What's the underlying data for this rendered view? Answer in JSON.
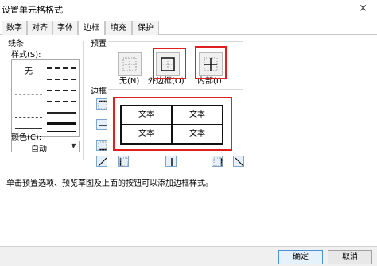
{
  "window": {
    "title": "设置单元格格式",
    "close_glyph": "×"
  },
  "tabs": [
    {
      "label": "数字"
    },
    {
      "label": "对齐"
    },
    {
      "label": "字体"
    },
    {
      "label": "边框"
    },
    {
      "label": "填充"
    },
    {
      "label": "保护"
    }
  ],
  "active_tab": "边框",
  "line_group": {
    "title": "线条",
    "style_label": "样式(S):",
    "none_label": "无",
    "color_label": "颜色(C):",
    "color_value": "自动"
  },
  "presets": {
    "title": "预置",
    "items": [
      {
        "label": "无(N)"
      },
      {
        "label": "外边框(O)"
      },
      {
        "label": "内部(I)"
      }
    ]
  },
  "border": {
    "title": "边框",
    "preview_cells": [
      "文本",
      "文本",
      "文本",
      "文本"
    ]
  },
  "hint": "单击预置选项、预览草图及上面的按钮可以添加边框样式。",
  "footer": {
    "ok_label": "确定",
    "cancel_label": "取消"
  },
  "colors": {
    "highlight_red": "#e02020",
    "button_blue": "#4a90d9"
  }
}
